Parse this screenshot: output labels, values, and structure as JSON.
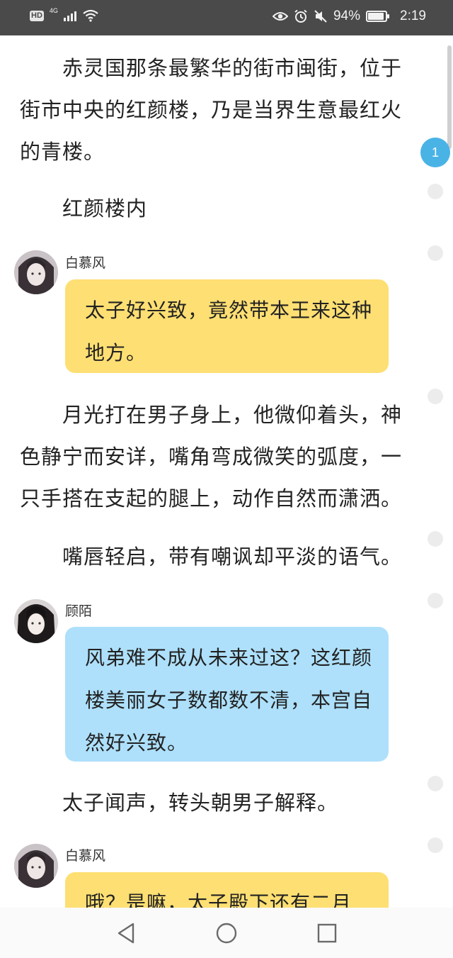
{
  "status_bar": {
    "hd": "HD",
    "network": "4G",
    "battery": "94%",
    "battery_level": 0.94,
    "time": "2:19",
    "icons": [
      "eye-icon",
      "alarm-icon",
      "mute-icon",
      "battery-icon"
    ]
  },
  "comment_count": "1",
  "story": [
    {
      "type": "narration",
      "text": "赤灵国那条最繁华的街市闽街，位于街市中央的红颜楼，乃是当界生意最红火的青楼。"
    },
    {
      "type": "narration",
      "text": "红颜楼内"
    },
    {
      "type": "dialogue",
      "speaker": "白慕风",
      "color": "#fedf73",
      "text": "太子好兴致，竟然带本王来这种地方。"
    },
    {
      "type": "narration",
      "text": "月光打在男子身上，他微仰着头，神色静宁而安详，嘴角弯成微笑的弧度，一只手搭在支起的腿上，动作自然而潇洒。"
    },
    {
      "type": "narration",
      "text": "嘴唇轻启，带有嘲讽却平淡的语气。"
    },
    {
      "type": "dialogue",
      "speaker": "顾陌",
      "color": "#aee0fb",
      "text": "风弟难不成从未来过这？这红颜楼美丽女子数都数不清，本宫自然好兴致。"
    },
    {
      "type": "narration",
      "text": "太子闻声，转头朝男子解释。"
    },
    {
      "type": "dialogue",
      "speaker": "白慕风",
      "color": "#fedf73",
      "text": "哦？是嘛，太子殿下还有二月"
    }
  ],
  "nav_bar": [
    "back-icon",
    "home-icon",
    "recents-icon"
  ]
}
